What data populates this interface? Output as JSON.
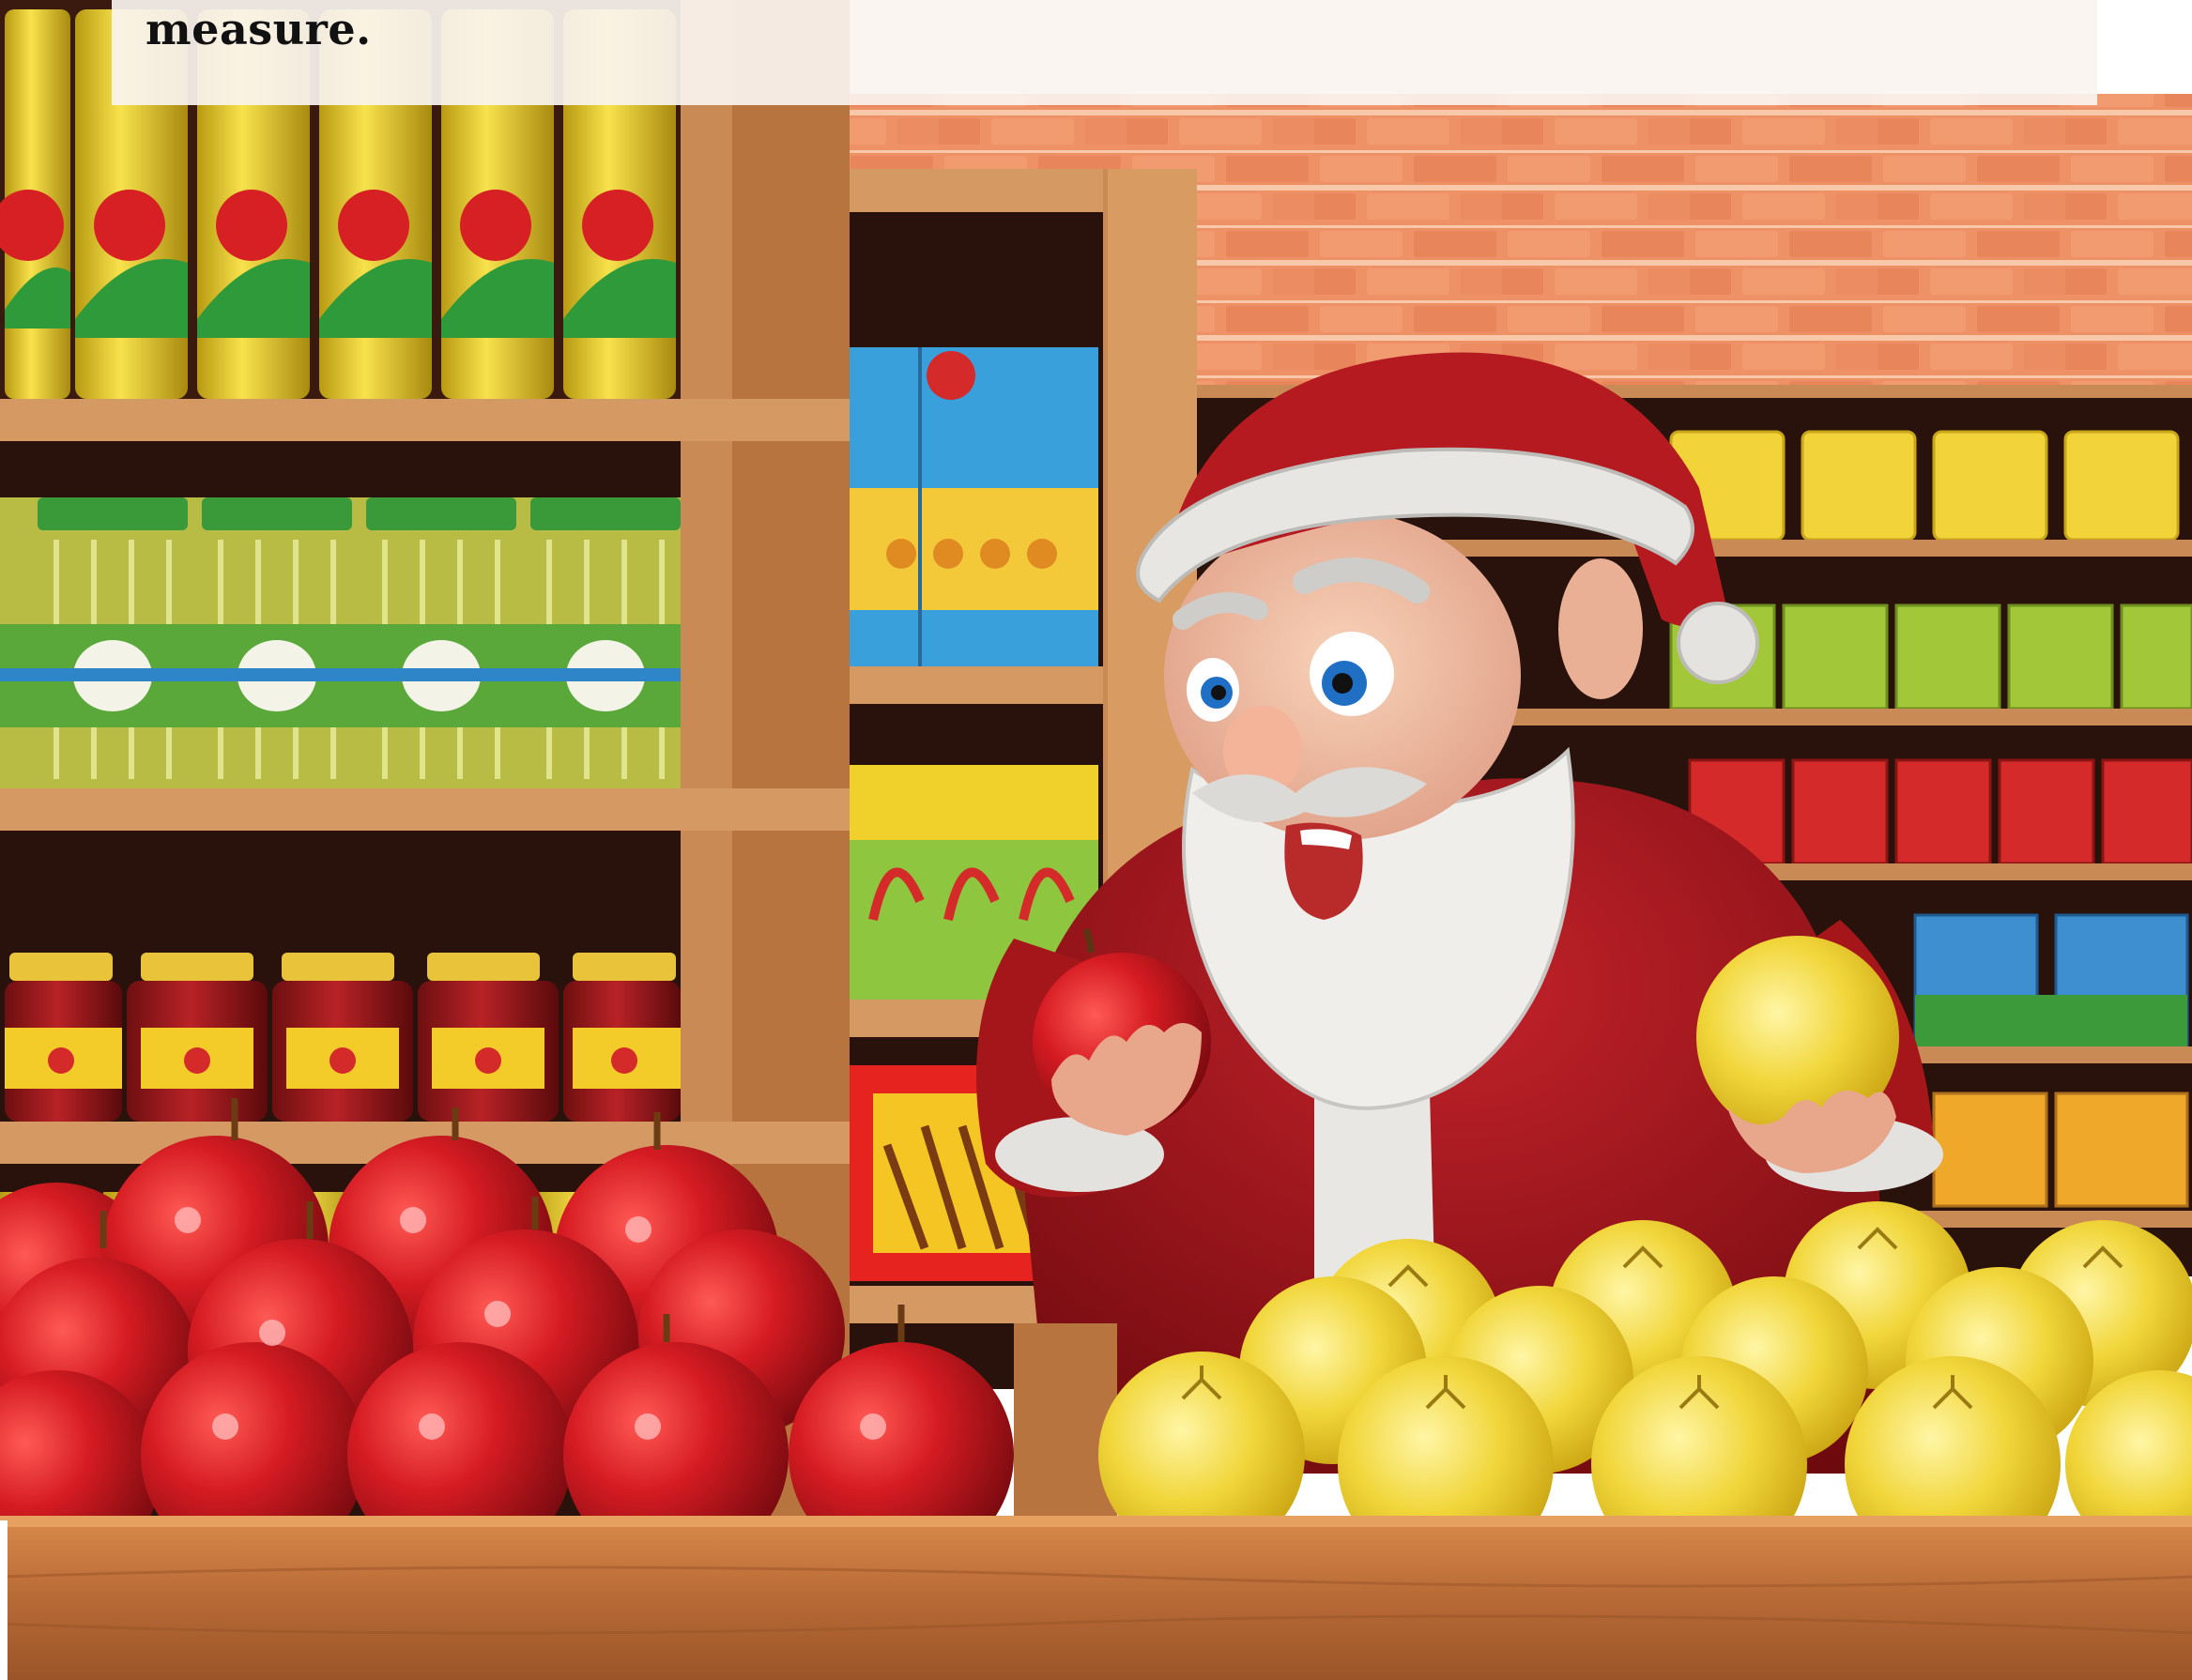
{
  "caption": {
    "text": "measure."
  },
  "colors": {
    "brick": "#e98a60",
    "shelf_wood": "#c98a55",
    "shelf_dark": "#2a120c",
    "apple_red": "#c4121b",
    "grapefruit_yellow": "#ecd02e",
    "santa_red": "#a6161b",
    "counter_wood": "#b86a36"
  },
  "scene": {
    "subject": "santa-claus-holding-apple-and-grapefruit",
    "icons": [
      "apple-icon",
      "grapefruit-icon",
      "santa-hat-icon"
    ]
  }
}
